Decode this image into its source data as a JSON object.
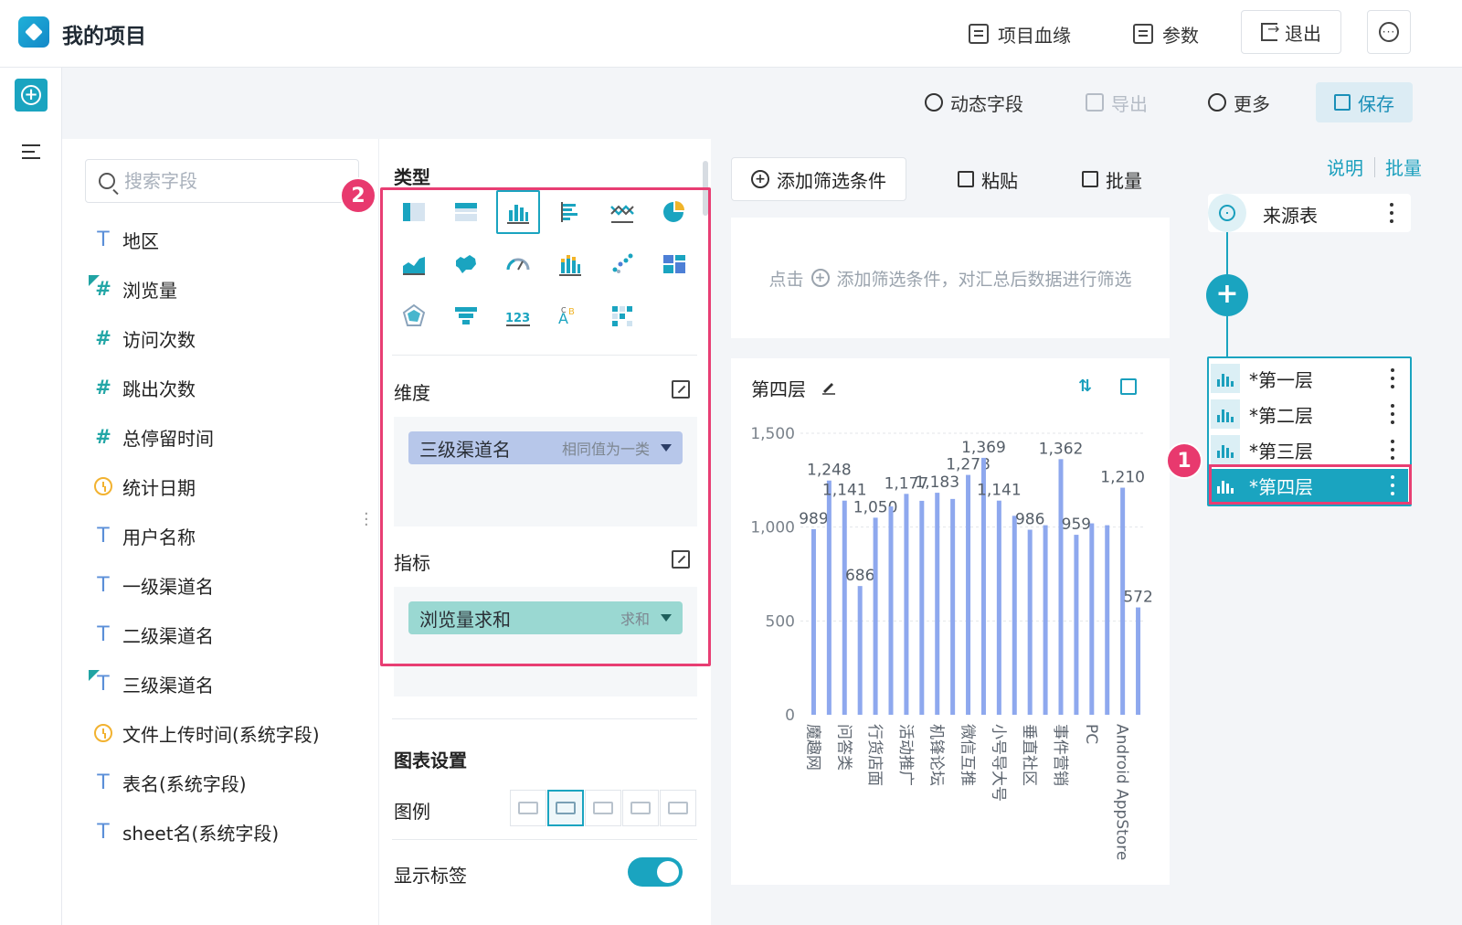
{
  "app": {
    "title": "我的项目"
  },
  "topbar": {
    "lineage_label": "项目血缘",
    "params_label": "参数",
    "exit_label": "退出"
  },
  "toolbar": {
    "dynamic_field_label": "动态字段",
    "export_label": "导出",
    "more_label": "更多",
    "save_label": "保存"
  },
  "fields": {
    "search_placeholder": "搜索字段",
    "items": [
      {
        "type": "text",
        "label": "地区",
        "flagged": false
      },
      {
        "type": "number",
        "label": "浏览量",
        "flagged": true
      },
      {
        "type": "number",
        "label": "访问次数",
        "flagged": false
      },
      {
        "type": "number",
        "label": "跳出次数",
        "flagged": false
      },
      {
        "type": "number",
        "label": "总停留时间",
        "flagged": false
      },
      {
        "type": "date",
        "label": "统计日期",
        "flagged": false
      },
      {
        "type": "text",
        "label": "用户名称",
        "flagged": false
      },
      {
        "type": "text",
        "label": "一级渠道名",
        "flagged": false
      },
      {
        "type": "text",
        "label": "二级渠道名",
        "flagged": false
      },
      {
        "type": "text",
        "label": "三级渠道名",
        "flagged": true
      },
      {
        "type": "date",
        "label": "文件上传时间(系统字段)",
        "flagged": false
      },
      {
        "type": "text",
        "label": "表名(系统字段)",
        "flagged": false
      },
      {
        "type": "text",
        "label": "sheet名(系统字段)",
        "flagged": false
      }
    ]
  },
  "config": {
    "type_label": "类型",
    "chart_types": [
      "table",
      "cross-table",
      "bar",
      "horizontal-bar",
      "combo",
      "pie",
      "area",
      "map",
      "gauge",
      "stacked-bar",
      "scatter",
      "tile",
      "radar",
      "funnel",
      "kpi-number",
      "word-cloud",
      "heatmap"
    ],
    "active_chart_type": "bar",
    "dimension_label": "维度",
    "dimension_pill": {
      "label": "三级渠道名",
      "sub": "相同值为一类"
    },
    "metric_label": "指标",
    "metric_pill": {
      "label": "浏览量求和",
      "sub": "求和"
    },
    "chart_settings_label": "图表设置",
    "legend_label": "图例",
    "show_labels_label": "显示标签",
    "show_labels_on": true
  },
  "filter": {
    "add_label": "添加筛选条件",
    "paste_label": "粘贴",
    "batch_label": "批量",
    "empty_prefix": "点击",
    "empty_text": "添加筛选条件，对汇总后数据进行筛选"
  },
  "chart_card": {
    "title": "第四层"
  },
  "chart_data": {
    "type": "bar",
    "title": "",
    "xlabel": "",
    "ylabel": "",
    "ylim": [
      0,
      1500
    ],
    "yticks": [
      "0",
      "500",
      "1,000",
      "1,500"
    ],
    "grid": true,
    "categories": [
      "魔趣网",
      "",
      "问答类",
      "",
      "行货店面",
      "",
      "活动推广",
      "",
      "机锋论坛",
      "",
      "微信互推",
      "",
      "小号导大号",
      "",
      "垂直社区",
      "",
      "事件营销",
      "",
      "PC",
      "",
      "Android AppStore",
      ""
    ],
    "values": [
      989,
      1248,
      1141,
      686,
      1050,
      1110,
      1177,
      1140,
      1183,
      1150,
      1278,
      1369,
      1141,
      1060,
      986,
      1010,
      1362,
      959,
      1020,
      1010,
      1210,
      572
    ],
    "data_labels": [
      "989",
      "1,248",
      "1,141",
      "686",
      "1,050",
      "",
      "1,177",
      "",
      "1,183",
      "",
      "1,278",
      "1,369",
      "1,141",
      "",
      "986",
      "",
      "1,362",
      "959",
      "",
      "",
      "1,210",
      "572"
    ],
    "color": "#8ea8ee"
  },
  "right_panel": {
    "explain_label": "说明",
    "batch_label": "批量",
    "source_label": "来源表",
    "layers": [
      "*第一层",
      "*第二层",
      "*第三层",
      "*第四层"
    ],
    "active_layer": 3
  },
  "annotations": {
    "badge1": "1",
    "badge2": "2"
  },
  "colors": {
    "accent": "#1aa4c0",
    "highlight": "#e83e73",
    "bar": "#8ea8ee"
  }
}
